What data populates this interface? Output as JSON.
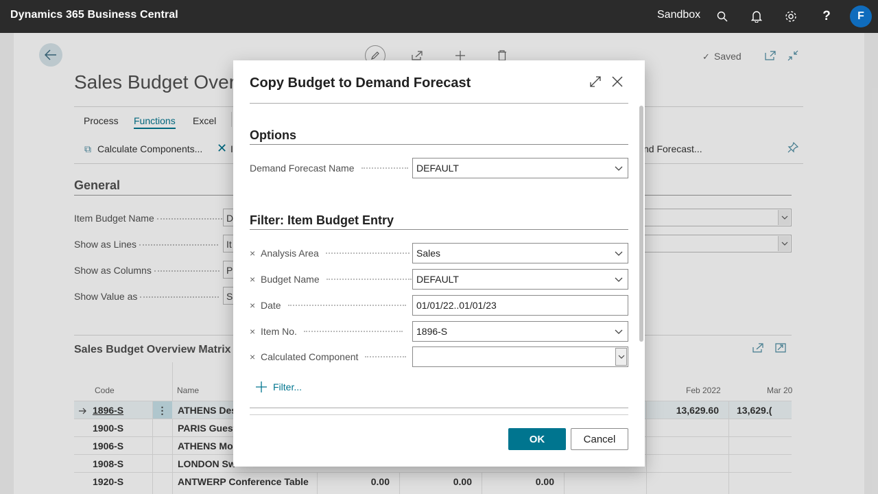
{
  "topbar": {
    "brand": "Dynamics 365 Business Central",
    "environment": "Sandbox",
    "avatar_initial": "F"
  },
  "page": {
    "title": "Sales Budget Over",
    "status": "Saved",
    "actions": [
      "Process",
      "Functions",
      "Excel"
    ],
    "sub_actions": {
      "calc": "Calculate Components...",
      "close_letter": "I",
      "forecast_tail": "nd Forecast..."
    },
    "general": {
      "title": "General",
      "fields": [
        {
          "label": "Item Budget Name",
          "value": "D"
        },
        {
          "label": "Show as Lines",
          "value": "It"
        },
        {
          "label": "Show as Columns",
          "value": "Pe"
        },
        {
          "label": "Show Value as",
          "value": "S"
        }
      ]
    },
    "matrix": {
      "title": "Sales Budget Overview Matrix",
      "headers": {
        "code": "Code",
        "name": "Name",
        "feb": "Feb 2022",
        "mar": "Mar 20"
      },
      "rows": [
        {
          "code": "1896-S",
          "name": "ATHENS Des",
          "c1": "",
          "c2": "",
          "c3": "",
          "feb": "13,629.60",
          "mar": "13,629.("
        },
        {
          "code": "1900-S",
          "name": "PARIS Guest",
          "c1": "",
          "c2": "",
          "c3": "",
          "feb": "",
          "mar": ""
        },
        {
          "code": "1906-S",
          "name": "ATHENS Mo",
          "c1": "",
          "c2": "",
          "c3": "",
          "feb": "",
          "mar": ""
        },
        {
          "code": "1908-S",
          "name": "LONDON Sw",
          "c1": "",
          "c2": "",
          "c3": "",
          "feb": "",
          "mar": ""
        },
        {
          "code": "1920-S",
          "name": "ANTWERP Conference Table",
          "c1": "0.00",
          "c2": "0.00",
          "c3": "0.00",
          "feb": "",
          "mar": ""
        }
      ]
    }
  },
  "dialog": {
    "title": "Copy Budget to Demand Forecast",
    "options_title": "Options",
    "demand_forecast_name": {
      "label": "Demand Forecast Name",
      "value": "DEFAULT"
    },
    "filter_title": "Filter: Item Budget Entry",
    "filters": [
      {
        "label": "Analysis Area",
        "value": "Sales"
      },
      {
        "label": "Budget Name",
        "value": "DEFAULT"
      },
      {
        "label": "Date",
        "value": "01/01/22..01/01/23"
      },
      {
        "label": "Item No.",
        "value": "1896-S"
      },
      {
        "label": "Calculated Component",
        "value": ""
      }
    ],
    "filter_link": "Filter...",
    "ok": "OK",
    "cancel": "Cancel"
  }
}
